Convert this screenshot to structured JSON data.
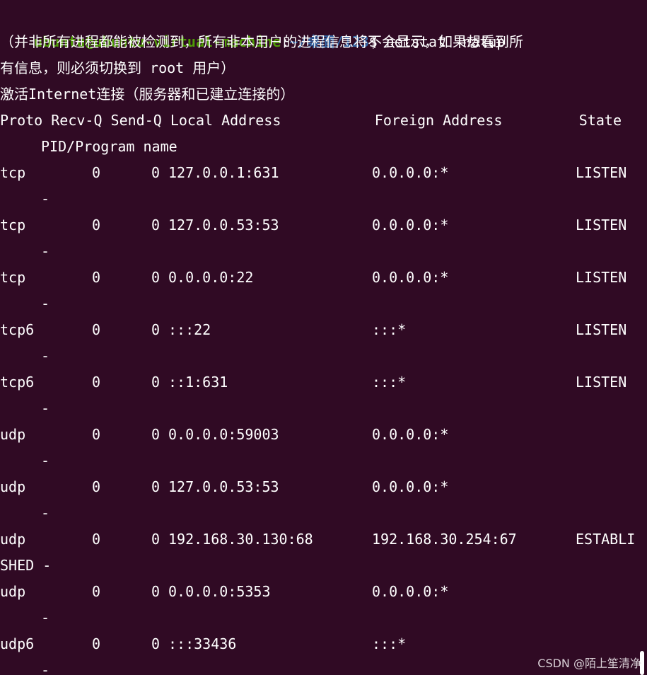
{
  "terminal": {
    "prompt": {
      "user_host": "ubuntu@ubuntu-virtual-machine",
      "colon": ":",
      "path": "~/桌面/123",
      "sign": "$ ",
      "command": "netstat -natup"
    },
    "messages": [
      "（并非所有进程都能被检测到，所有非本用户的进程信息将不会显示，如果想看到所",
      "有信息，则必须切换到 root 用户）",
      "激活Internet连接（服务器和已建立连接的）"
    ],
    "header": {
      "line1": "Proto Recv-Q Send-Q Local Address           Foreign Address         State",
      "line2": "PID/Program name"
    },
    "rows": [
      {
        "proto": "tcp",
        "recv": "0",
        "send": "0",
        "local": "127.0.0.1:631",
        "foreign": "0.0.0.0:*",
        "state": "LISTEN",
        "pid": "-"
      },
      {
        "proto": "tcp",
        "recv": "0",
        "send": "0",
        "local": "127.0.0.53:53",
        "foreign": "0.0.0.0:*",
        "state": "LISTEN",
        "pid": "-"
      },
      {
        "proto": "tcp",
        "recv": "0",
        "send": "0",
        "local": "0.0.0.0:22",
        "foreign": "0.0.0.0:*",
        "state": "LISTEN",
        "pid": "-"
      },
      {
        "proto": "tcp6",
        "recv": "0",
        "send": "0",
        "local": ":::22",
        "foreign": ":::*",
        "state": "LISTEN",
        "pid": "-"
      },
      {
        "proto": "tcp6",
        "recv": "0",
        "send": "0",
        "local": "::1:631",
        "foreign": ":::*",
        "state": "LISTEN",
        "pid": "-"
      },
      {
        "proto": "udp",
        "recv": "0",
        "send": "0",
        "local": "0.0.0.0:59003",
        "foreign": "0.0.0.0:*",
        "state": "",
        "pid": "-"
      },
      {
        "proto": "udp",
        "recv": "0",
        "send": "0",
        "local": "127.0.0.53:53",
        "foreign": "0.0.0.0:*",
        "state": "",
        "pid": "-"
      },
      {
        "proto": "udp",
        "recv": "0",
        "send": "0",
        "local": "192.168.30.130:68",
        "foreign": "192.168.30.254:67",
        "state": "ESTABLI",
        "pid": "SHED -"
      },
      {
        "proto": "udp",
        "recv": "0",
        "send": "0",
        "local": "0.0.0.0:5353",
        "foreign": "0.0.0.0:*",
        "state": "",
        "pid": "-"
      },
      {
        "proto": "udp6",
        "recv": "0",
        "send": "0",
        "local": ":::33436",
        "foreign": ":::*",
        "state": "",
        "pid": "-"
      }
    ]
  },
  "watermark": "CSDN @陌上笙清净",
  "colors": {
    "background": "#300a24",
    "text": "#ffffff",
    "prompt_user": "#4e9a06",
    "prompt_path": "#3465a4"
  }
}
